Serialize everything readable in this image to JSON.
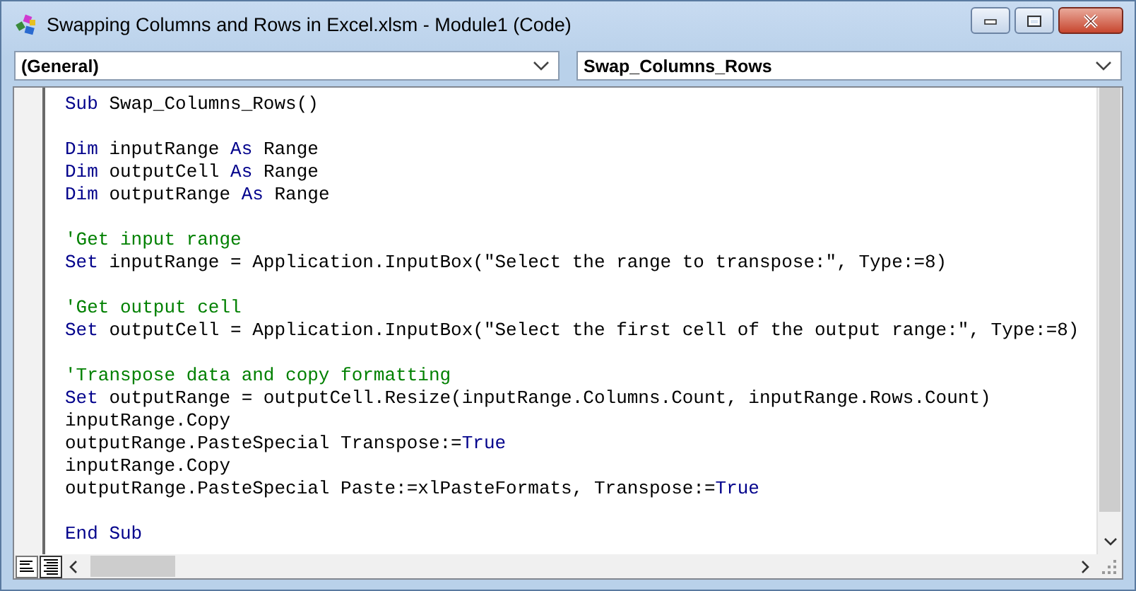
{
  "window": {
    "title": "Swapping Columns and Rows in Excel.xlsm - Module1 (Code)"
  },
  "dropdowns": [
    {
      "value": "(General)"
    },
    {
      "value": "Swap_Columns_Rows"
    }
  ],
  "code_lines": [
    {
      "kind": "code",
      "tokens": [
        {
          "kind": "keyword",
          "text": "Sub"
        },
        {
          "kind": "text",
          "text": " Swap_Columns_Rows()"
        }
      ]
    },
    {
      "kind": "blank"
    },
    {
      "kind": "code",
      "tokens": [
        {
          "kind": "keyword",
          "text": "Dim"
        },
        {
          "kind": "text",
          "text": " inputRange "
        },
        {
          "kind": "keyword",
          "text": "As"
        },
        {
          "kind": "text",
          "text": " Range"
        }
      ]
    },
    {
      "kind": "code",
      "tokens": [
        {
          "kind": "keyword",
          "text": "Dim"
        },
        {
          "kind": "text",
          "text": " outputCell "
        },
        {
          "kind": "keyword",
          "text": "As"
        },
        {
          "kind": "text",
          "text": " Range"
        }
      ]
    },
    {
      "kind": "code",
      "tokens": [
        {
          "kind": "keyword",
          "text": "Dim"
        },
        {
          "kind": "text",
          "text": " outputRange "
        },
        {
          "kind": "keyword",
          "text": "As"
        },
        {
          "kind": "text",
          "text": " Range"
        }
      ]
    },
    {
      "kind": "blank"
    },
    {
      "kind": "code",
      "tokens": [
        {
          "kind": "comment",
          "text": "'Get input range"
        }
      ]
    },
    {
      "kind": "code",
      "tokens": [
        {
          "kind": "keyword",
          "text": "Set"
        },
        {
          "kind": "text",
          "text": " inputRange = Application.InputBox(\"Select the range to transpose:\", Type:=8)"
        }
      ]
    },
    {
      "kind": "blank"
    },
    {
      "kind": "code",
      "tokens": [
        {
          "kind": "comment",
          "text": "'Get output cell"
        }
      ]
    },
    {
      "kind": "code",
      "tokens": [
        {
          "kind": "keyword",
          "text": "Set"
        },
        {
          "kind": "text",
          "text": " outputCell = Application.InputBox(\"Select the first cell of the output range:\", Type:=8)"
        }
      ]
    },
    {
      "kind": "blank"
    },
    {
      "kind": "code",
      "tokens": [
        {
          "kind": "comment",
          "text": "'Transpose data and copy formatting"
        }
      ]
    },
    {
      "kind": "code",
      "tokens": [
        {
          "kind": "keyword",
          "text": "Set"
        },
        {
          "kind": "text",
          "text": " outputRange = outputCell.Resize(inputRange.Columns.Count, inputRange.Rows.Count)"
        }
      ]
    },
    {
      "kind": "code",
      "tokens": [
        {
          "kind": "text",
          "text": "inputRange.Copy"
        }
      ]
    },
    {
      "kind": "code",
      "tokens": [
        {
          "kind": "text",
          "text": "outputRange.PasteSpecial Transpose:="
        },
        {
          "kind": "keyword",
          "text": "True"
        }
      ]
    },
    {
      "kind": "code",
      "tokens": [
        {
          "kind": "text",
          "text": "inputRange.Copy"
        }
      ]
    },
    {
      "kind": "code",
      "tokens": [
        {
          "kind": "text",
          "text": "outputRange.PasteSpecial Paste:=xlPasteFormats, Transpose:="
        },
        {
          "kind": "keyword",
          "text": "True"
        }
      ]
    },
    {
      "kind": "blank"
    },
    {
      "kind": "code",
      "tokens": [
        {
          "kind": "keyword",
          "text": "End Sub"
        }
      ]
    }
  ]
}
